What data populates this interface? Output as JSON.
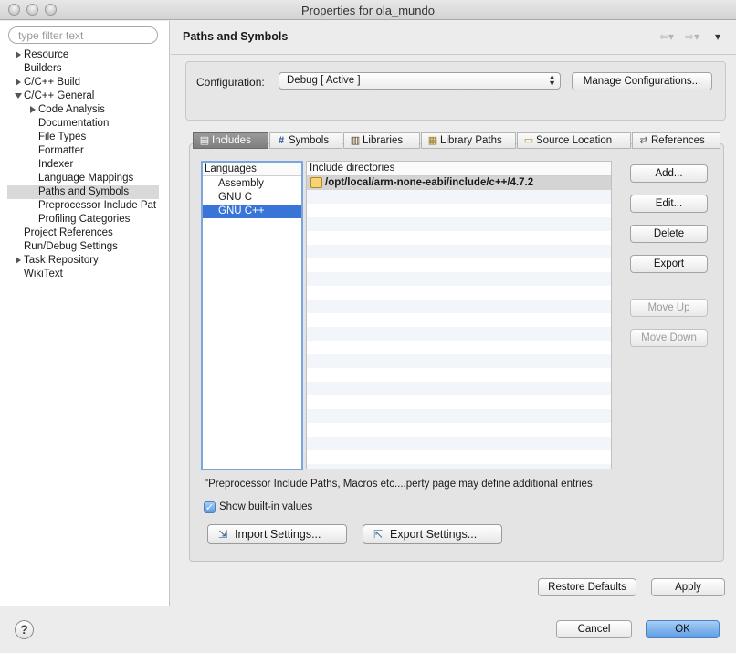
{
  "window": {
    "title": "Properties for ola_mundo"
  },
  "sidebar": {
    "filter_placeholder": "type filter text",
    "items": [
      {
        "label": "Resource"
      },
      {
        "label": "Builders"
      },
      {
        "label": "C/C++ Build"
      },
      {
        "label": "C/C++ General"
      },
      {
        "label": "Code Analysis"
      },
      {
        "label": "Documentation"
      },
      {
        "label": "File Types"
      },
      {
        "label": "Formatter"
      },
      {
        "label": "Indexer"
      },
      {
        "label": "Language Mappings"
      },
      {
        "label": "Paths and Symbols"
      },
      {
        "label": "Preprocessor Include Pat"
      },
      {
        "label": "Profiling Categories"
      },
      {
        "label": "Project References"
      },
      {
        "label": "Run/Debug Settings"
      },
      {
        "label": "Task Repository"
      },
      {
        "label": "WikiText"
      }
    ]
  },
  "header": {
    "title": "Paths and Symbols"
  },
  "config": {
    "label": "Configuration:",
    "selected": "Debug  [ Active ]",
    "manage_label": "Manage Configurations..."
  },
  "tabs": [
    {
      "label": "Includes",
      "icon": "includes-icon"
    },
    {
      "label": "Symbols",
      "icon": "hash-icon"
    },
    {
      "label": "Libraries",
      "icon": "libraries-icon"
    },
    {
      "label": "Library Paths",
      "icon": "library-paths-icon"
    },
    {
      "label": "Source Location",
      "icon": "source-folder-icon"
    },
    {
      "label": "References",
      "icon": "references-icon"
    }
  ],
  "languages": {
    "header": "Languages",
    "items": [
      "Assembly",
      "GNU C",
      "GNU C++"
    ],
    "selected": "GNU C++"
  },
  "includes": {
    "header": "Include directories",
    "rows": [
      "/opt/local/arm-none-eabi/include/c++/4.7.2"
    ]
  },
  "side_buttons": {
    "add": "Add...",
    "edit": "Edit...",
    "delete": "Delete",
    "export": "Export",
    "move_up": "Move Up",
    "move_down": "Move Down"
  },
  "note": "\"Preprocessor Include Paths, Macros etc....perty page may define additional entries",
  "show_builtin": {
    "label": "Show built-in values",
    "checked": true
  },
  "import_settings": "Import Settings...",
  "export_settings": "Export Settings...",
  "restore_defaults": "Restore Defaults",
  "apply": "Apply",
  "cancel": "Cancel",
  "ok": "OK",
  "help": "?"
}
